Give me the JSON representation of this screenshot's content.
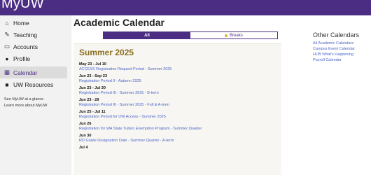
{
  "app": {
    "brand": "MyUW"
  },
  "sidebar": {
    "items": [
      {
        "label": "Home",
        "icon": "home-icon",
        "glyph": "⌂"
      },
      {
        "label": "Teaching",
        "icon": "edit-icon",
        "glyph": "✎"
      },
      {
        "label": "Accounts",
        "icon": "wallet-icon",
        "glyph": "▭"
      },
      {
        "label": "Profile",
        "icon": "user-icon",
        "glyph": "●"
      },
      {
        "label": "Calendar",
        "icon": "calendar-icon",
        "glyph": "▦"
      },
      {
        "label": "UW Resources",
        "icon": "bookmark-icon",
        "glyph": "■"
      }
    ],
    "links": [
      "See MyUW at a glance",
      "Learn more about MyUW"
    ]
  },
  "main": {
    "title": "Academic Calendar",
    "tabs": [
      {
        "label": "All"
      },
      {
        "label": "Breaks"
      }
    ],
    "section_title": "Summer 2025",
    "events": [
      {
        "date": "May 23 - Jul 10",
        "title": "ACCESS Registration Request Period - Summer 2025"
      },
      {
        "date": "Jun 23 - Sep 23",
        "title": "Registration Period II - Autumn 2025"
      },
      {
        "date": "Jun 23 - Jul 30",
        "title": "Registration Period III - Summer 2025 - B-term"
      },
      {
        "date": "Jun 23 - 29",
        "title": "Registration Period III - Summer 2025 - Full & A-term"
      },
      {
        "date": "Jun 25 - Jul 11",
        "title": "Registration Period for UW Access - Summer 2025"
      },
      {
        "date": "Jun 26",
        "title": "Registration for WA State Tuition Exemption Program - Summer Quarter"
      },
      {
        "date": "Jun 30",
        "title": "RD Grade Designation Date - Summer Quarter - A-term"
      },
      {
        "date": "Jul 4",
        "title": ""
      }
    ]
  },
  "right": {
    "title": "Other Calendars",
    "links": [
      "All Academic Calendars",
      "Campus Event Calendar",
      "HUB What's Happening",
      "Payroll Calendar"
    ]
  },
  "colors": {
    "brand": "#4b2e83",
    "gold": "#8a6d1f",
    "link": "#4b66c7",
    "breaks_dot": "#d4b347"
  }
}
